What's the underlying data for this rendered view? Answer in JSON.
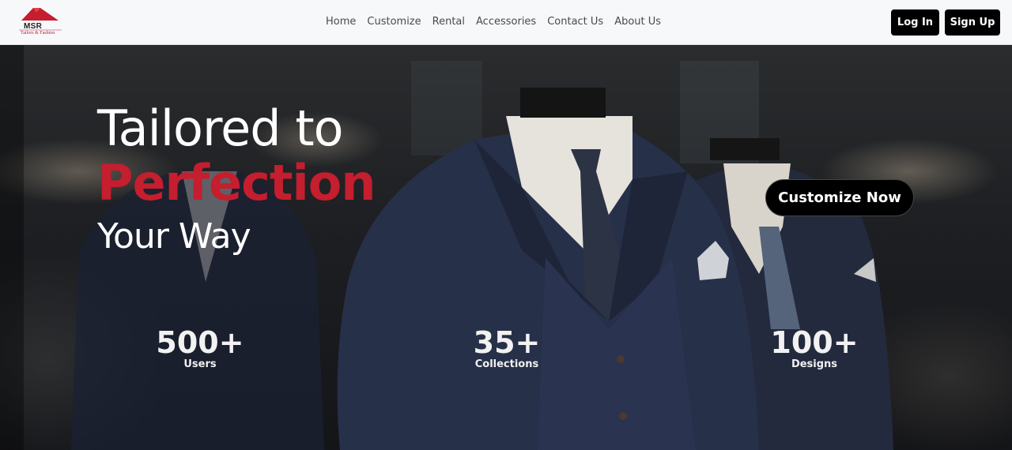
{
  "brand": {
    "name": "MSR",
    "tagline": "Tailors & Fashion"
  },
  "nav": {
    "links": [
      "Home",
      "Customize",
      "Rental",
      "Accessories",
      "Contact Us",
      "About Us"
    ],
    "login_label": "Log In",
    "signup_label": "Sign Up"
  },
  "hero": {
    "line1": "Tailored to",
    "line2": "Perfection",
    "line3": "Your Way",
    "cta_label": "Customize Now"
  },
  "stats": [
    {
      "value": "500+",
      "label": "Users"
    },
    {
      "value": "35+",
      "label": "Collections"
    },
    {
      "value": "100+",
      "label": "Designs"
    }
  ],
  "colors": {
    "accent": "#c41e2f",
    "nav_bg": "#f7f8fa",
    "button_bg": "#000000"
  }
}
